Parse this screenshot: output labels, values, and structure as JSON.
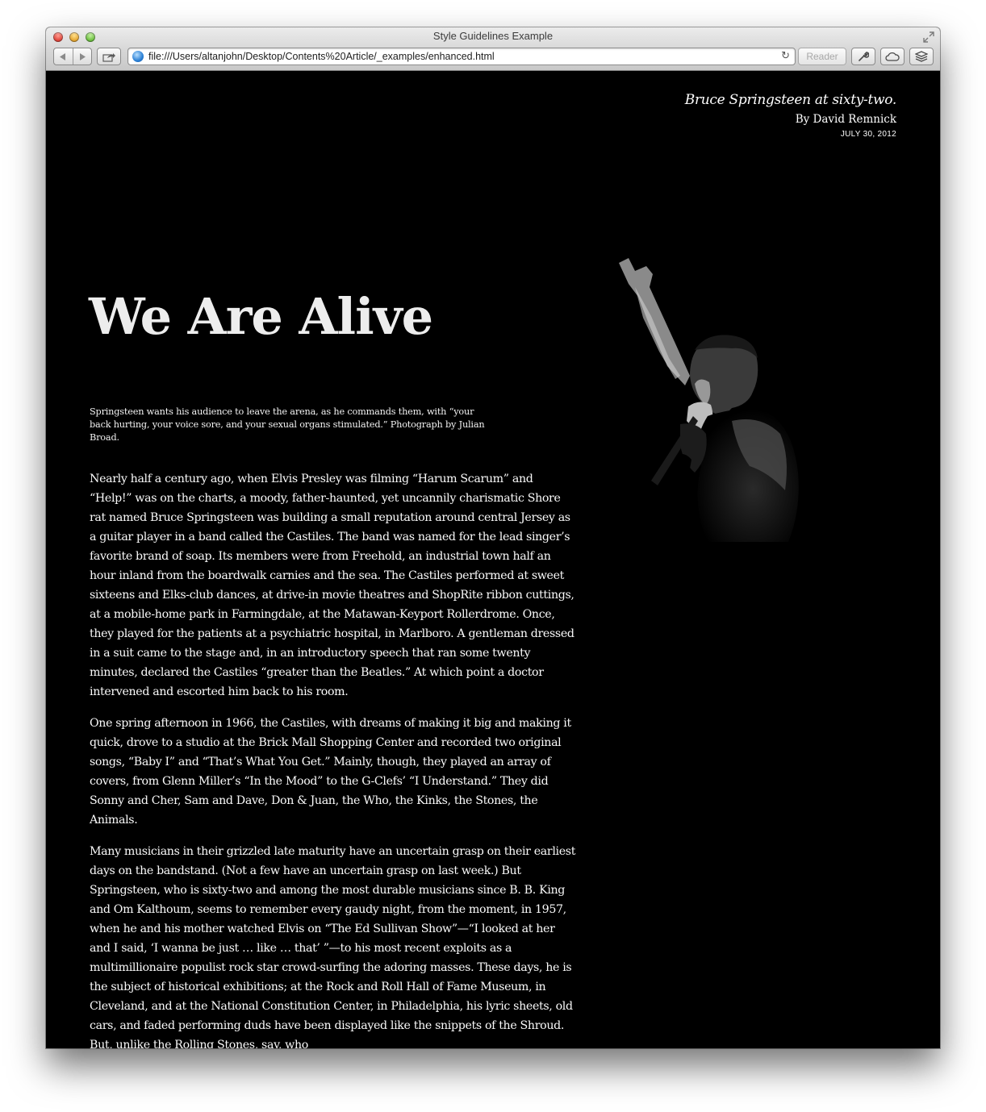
{
  "window": {
    "title": "Style Guidelines Example",
    "url": "file:///Users/altanjohn/Desktop/Contents%20Article/_examples/enhanced.html",
    "reader_label": "Reader"
  },
  "article": {
    "dek": "Bruce Springsteen at sixty-two.",
    "byline": "By David Remnick",
    "date": "JULY 30, 2012",
    "headline": "We Are Alive",
    "caption": "Springsteen wants his audience to leave the arena, as he commands them, with “your back hurting, your voice sore, and your sexual organs stimulated.” Photograph by Julian Broad.",
    "paragraphs": [
      "Nearly half a century ago, when Elvis Presley was filming “Harum Scarum” and “Help!” was on the charts, a moody, father-haunted, yet uncannily charismatic Shore rat named Bruce Springsteen was building a small reputation around central Jersey as a guitar player in a band called the Castiles. The band was named for the lead singer’s favorite brand of soap. Its members were from Freehold, an industrial town half an hour inland from the boardwalk carnies and the sea. The Castiles performed at sweet sixteens and Elks-club dances, at drive-in movie theatres and ShopRite ribbon cuttings, at a mobile-home park in Farmingdale, at the Matawan-Keyport Rollerdrome. Once, they played for the patients at a psychiatric hospital, in Marlboro. A gentleman dressed in a suit came to the stage and, in an introductory speech that ran some twenty minutes, declared the Castiles “greater than the Beatles.” At which point a doctor intervened and escorted him back to his room.",
      "One spring afternoon in 1966, the Castiles, with dreams of making it big and making it quick, drove to a studio at the Brick Mall Shopping Center and recorded two original songs, “Baby I” and “That’s What You Get.” Mainly, though, they played an array of covers, from Glenn Miller’s “In the Mood” to the G-Clefs’ “I Understand.” They did Sonny and Cher, Sam and Dave, Don & Juan, the Who, the Kinks, the Stones, the Animals.",
      "Many musicians in their grizzled late maturity have an uncertain grasp on their earliest days on the bandstand. (Not a few have an uncertain grasp on last week.) But Springsteen, who is sixty-two and among the most durable musicians since B. B. King and Om Kalthoum, seems to remember every gaudy night, from the moment, in 1957, when he and his mother watched Elvis on “The Ed Sullivan Show”—“I looked at her and I said, ‘I wanna be just … like … that’ ”—to his most recent exploits as a multimillionaire populist rock star crowd-surfing the adoring masses. These days, he is the subject of historical exhibitions; at the Rock and Roll Hall of Fame Museum, in Cleveland, and at the National Constitution Center, in Philadelphia, his lyric sheets, old cars, and faded performing duds have been displayed like the snippets of the Shroud. But, unlike the Rolling Stones, say, who"
    ]
  }
}
